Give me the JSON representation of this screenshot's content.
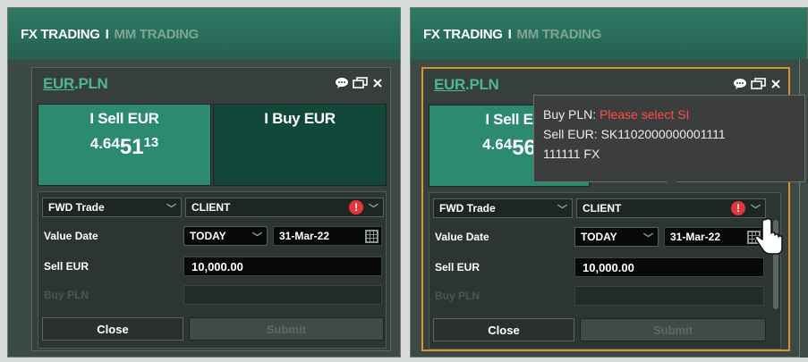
{
  "left_panel": {
    "nav": {
      "active_tab": "FX TRADING",
      "separator": "I",
      "inactive_tab": "MM TRADING"
    },
    "widget": {
      "pair_base": "EUR",
      "pair_dot": ".",
      "pair_quote": "PLN",
      "sell": {
        "label": "I Sell EUR",
        "rate_prefix": "4.64",
        "rate_big": "51",
        "rate_pips": "13"
      },
      "buy": {
        "label": "I Buy EUR"
      },
      "trade_type": "FWD Trade",
      "account": "CLIENT",
      "alert_glyph": "!",
      "value_date_label": "Value Date",
      "tenor": "TODAY",
      "date": "31-Mar-22",
      "sell_amount_label": "Sell EUR",
      "sell_amount": "10,000.00",
      "buy_amount_label": "Buy PLN",
      "close_label": "Close",
      "submit_label": "Submit"
    }
  },
  "right_panel": {
    "nav": {
      "active_tab": "FX TRADING",
      "separator": "I",
      "inactive_tab": "MM TRADING"
    },
    "widget": {
      "pair_base": "EUR",
      "pair_dot": ".",
      "pair_quote": "PLN",
      "sell": {
        "label": "I Sell E",
        "rate_prefix": "4.64",
        "rate_big": "56"
      },
      "trade_type": "FWD Trade",
      "account": "CLIENT",
      "alert_glyph": "!",
      "value_date_label": "Value Date",
      "tenor": "TODAY",
      "date": "31-Mar-22",
      "sell_amount_label": "Sell EUR",
      "sell_amount": "10,000.00",
      "buy_amount_label": "Buy PLN",
      "close_label": "Close",
      "submit_label": "Submit"
    },
    "tooltip": {
      "line1_label": "Buy PLN: ",
      "line1_error": "Please select SI",
      "line2": "Sell EUR: SK1102000000001111",
      "line3": "111111 FX"
    }
  },
  "colors": {
    "accent_green": "#4cb893",
    "sell_tile": "#2b8a6f",
    "buy_tile": "#12483a",
    "focus_border": "#d9922e",
    "alert_red": "#e2363a",
    "error_text": "#ff4d4d"
  },
  "icons": [
    "chat-icon",
    "popout-icon",
    "close-icon",
    "chevron-down-icon",
    "calendar-icon",
    "alert-icon",
    "mouse-cursor-icon"
  ]
}
